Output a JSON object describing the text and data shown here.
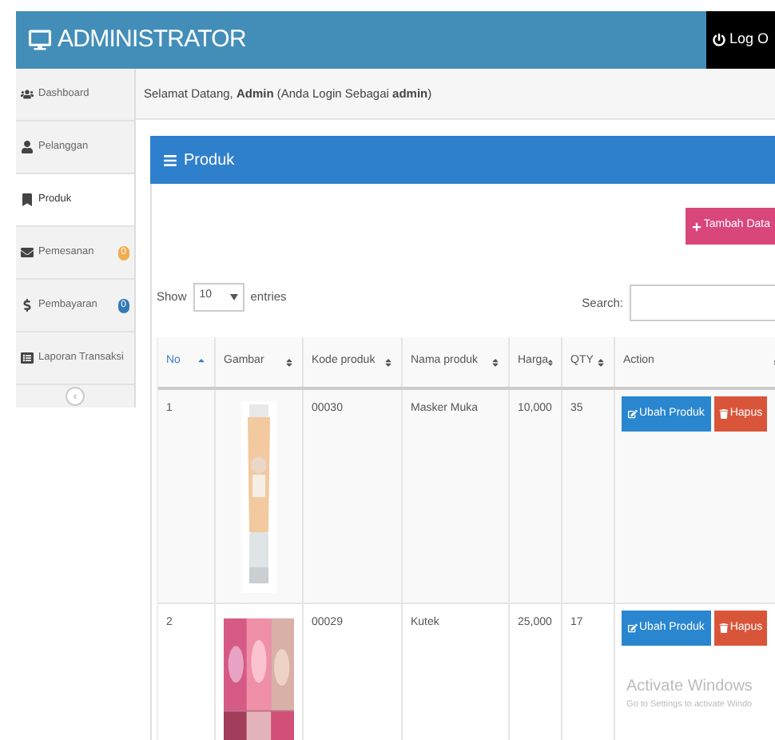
{
  "header": {
    "title": "ADMINISTRATOR",
    "logout": "Log O"
  },
  "sidebar": {
    "items": [
      {
        "label": "Dashboard",
        "selected": false
      },
      {
        "label": "Pelanggan",
        "selected": false
      },
      {
        "label": "Produk",
        "selected": true
      },
      {
        "label": "Pemesanan",
        "selected": false,
        "badge": "0",
        "color": "#f0ad4e"
      },
      {
        "label": "Pembayaran",
        "selected": false,
        "badge": "0",
        "color": "#337ab7"
      },
      {
        "label": "Laporan Transaksi",
        "selected": false
      }
    ],
    "collapse": "‹"
  },
  "welcome": "Selamat Datang, **Admin** (Anda Login Sebagai **admin**)",
  "panel": {
    "title": "Produk",
    "add_button": "Tambah Data",
    "show": "Show",
    "entries_value": "10",
    "entries": "entries",
    "search_label": "Search:",
    "columns": [
      {
        "label": "No",
        "sorted": true
      },
      {
        "label": "Gambar",
        "sorted": false
      },
      {
        "label": "Kode produk",
        "sorted": false
      },
      {
        "label": "Nama produk",
        "sorted": false
      },
      {
        "label": "Harga",
        "sorted": false
      },
      {
        "label": "QTY",
        "sorted": false
      },
      {
        "label": "Action",
        "sorted": false
      }
    ],
    "rows": [
      {
        "no": "1",
        "code": "00030",
        "name": "Masker Muka",
        "price": "10,000",
        "qty": "35",
        "edit": "Ubah Produk",
        "delete": "Hapus"
      },
      {
        "no": "2",
        "code": "00029",
        "name": "Kutek",
        "price": "25,000",
        "qty": "17",
        "edit": "Ubah Produk",
        "delete": "Hapus"
      }
    ]
  },
  "os_notice": {
    "title": "Activate Windows",
    "text": "Go to Settings to activate Windo"
  }
}
